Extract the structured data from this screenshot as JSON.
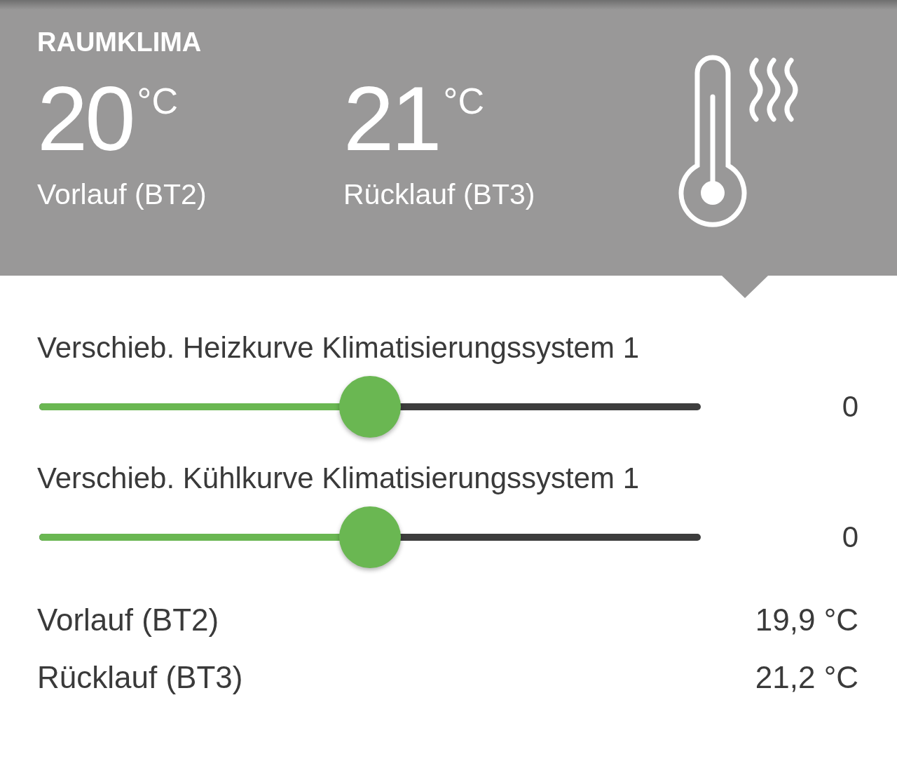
{
  "header": {
    "title": "RAUMKLIMA",
    "readings": [
      {
        "value": "20",
        "unit": "°C",
        "label": "Vorlauf (BT2)"
      },
      {
        "value": "21",
        "unit": "°C",
        "label": "Rücklauf (BT3)"
      }
    ]
  },
  "sliders": [
    {
      "label": "Verschieb. Heizkurve Klimatisierungssystem 1",
      "level": 0.5,
      "reading": "0"
    },
    {
      "label": "Verschieb. Kühlkurve Klimatisierungssystem 1",
      "level": 0.5,
      "reading": "0"
    }
  ],
  "rows": [
    {
      "label": "Vorlauf (BT2)",
      "value": "19,9 °C"
    },
    {
      "label": "Rücklauf (BT3)",
      "value": "21,2 °C"
    }
  ]
}
